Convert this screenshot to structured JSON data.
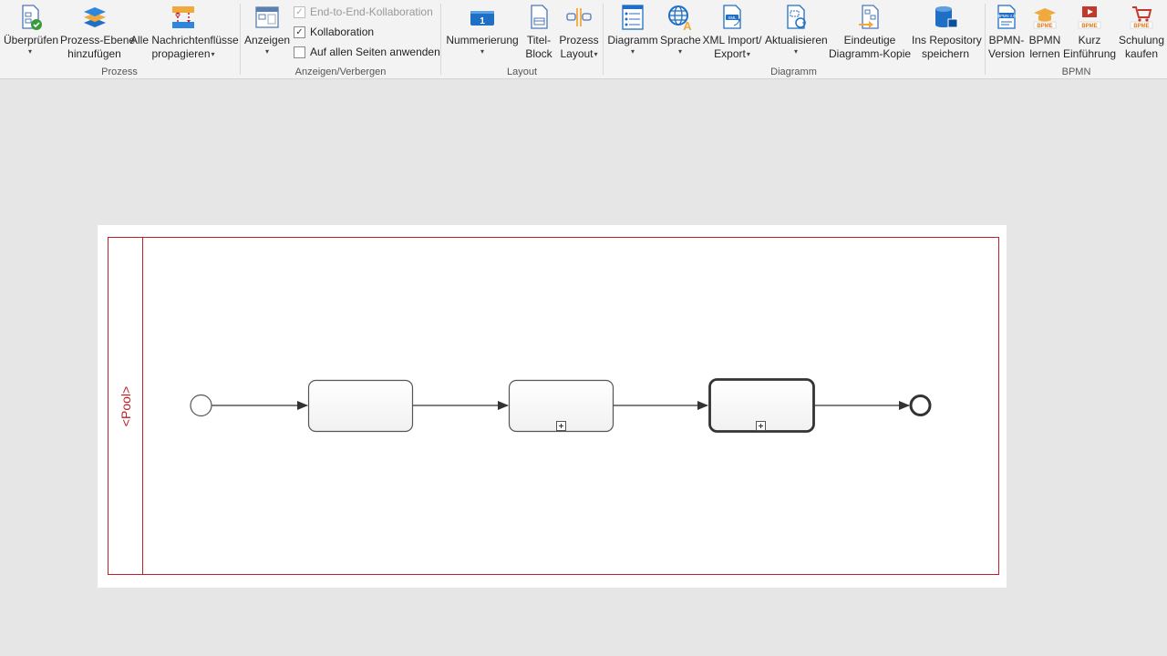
{
  "ribbon": {
    "groups": {
      "prozess": "Prozess",
      "anzeigen": "Anzeigen/Verbergen",
      "layout": "Layout",
      "diagramm": "Diagramm",
      "bpmn": "BPMN"
    },
    "buttons": {
      "ueberpruefen": "Überprüfen",
      "prozess_ebene_1": "Prozess-Ebene",
      "prozess_ebene_2": "hinzufügen",
      "nachrichten_1": "Alle Nachrichtenflüsse",
      "nachrichten_2": "propagieren",
      "anzeigen": "Anzeigen",
      "nummerierung": "Nummerierung",
      "titel_1": "Titel-",
      "titel_2": "Block",
      "prozess_layout_1": "Prozess",
      "prozess_layout_2": "Layout",
      "diagramm": "Diagramm",
      "sprache": "Sprache",
      "xml_1": "XML Import/",
      "xml_2": "Export",
      "aktualisieren": "Aktualisieren",
      "kopie_1": "Eindeutige",
      "kopie_2": "Diagramm-Kopie",
      "repo_1": "Ins Repository",
      "repo_2": "speichern",
      "bpmn_version_1": "BPMN-",
      "bpmn_version_2": "Version",
      "bpmn_lernen_1": "BPMN",
      "bpmn_lernen_2": "lernen",
      "kurz_1": "Kurz",
      "kurz_2": "Einführung",
      "schulung_1": "Schulung",
      "schulung_2": "kaufen"
    },
    "checkboxes": [
      {
        "label": "End-to-End-Kollaboration",
        "checked": true,
        "disabled": true
      },
      {
        "label": "Kollaboration",
        "checked": true,
        "disabled": false
      },
      {
        "label": "Auf allen Seiten anwenden",
        "checked": false,
        "disabled": false
      }
    ],
    "icon_texts": {
      "bpmn_version": "BPMN 2.0",
      "bpmne": "BPME",
      "xml": "XML"
    }
  },
  "canvas": {
    "pool_label": "<Pool>",
    "elements": [
      "start-event",
      "task",
      "collapsed-subprocess",
      "call-activity",
      "end-event"
    ]
  },
  "colors": {
    "pool_border": "#c0202a",
    "ribbon_bg": "#f3f3f3",
    "canvas_bg": "#e6e6e6",
    "accent_blue": "#1f6fc4",
    "accent_orange": "#f2a93b"
  }
}
